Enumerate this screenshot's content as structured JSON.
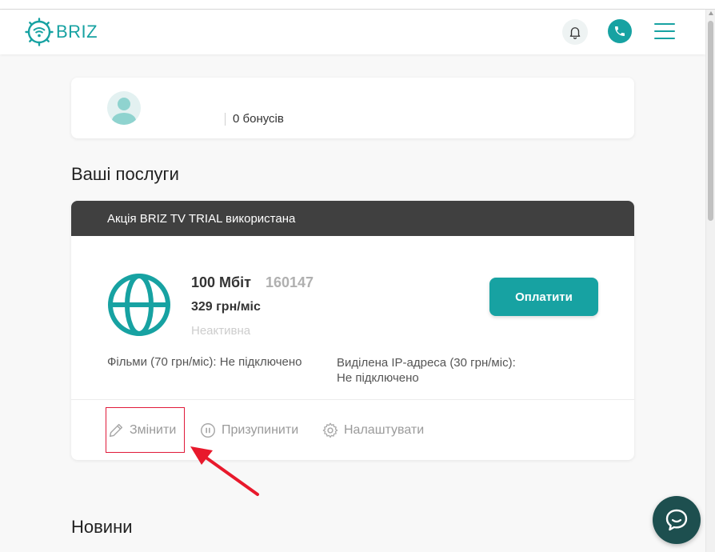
{
  "header": {
    "logo_text": "BRIZ",
    "icons": {
      "logo": "wifi-globe-icon",
      "bell": "bell-icon",
      "phone": "phone-icon",
      "menu": "hamburger-menu-icon"
    }
  },
  "profile": {
    "bonus_text": "0 бонусів",
    "avatar_icon": "user-avatar-icon"
  },
  "services": {
    "title": "Ваші послуги",
    "promo": "Акція BRIZ TV TRIAL використана",
    "plan": {
      "speed": "100 Мбіт",
      "contract_id": "160147",
      "price": "329 грн/міс",
      "status": "Неактивна",
      "icon": "globe-icon"
    },
    "pay_label": "Оплатити",
    "options": {
      "films": "Фільми (70 грн/міс): Не підключено",
      "ip_line1": "Виділена IP-адреса (30 грн/міс):",
      "ip_line2": "Не підключено"
    },
    "actions": {
      "change": "Змінити",
      "pause": "Призупинити",
      "settings": "Налаштувати"
    }
  },
  "news": {
    "title": "Новини"
  },
  "colors": {
    "accent": "#17a2a2",
    "promo_bar": "#404040",
    "chat": "#1d4f4f",
    "highlight": "#e01a3a"
  }
}
